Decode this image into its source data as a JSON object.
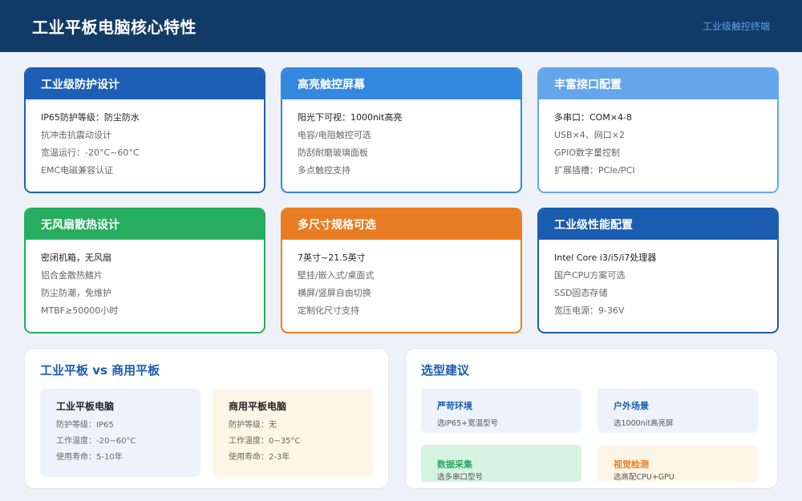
{
  "header": {
    "title": "工业平板电脑核心特性",
    "tag": "工业级触控终端"
  },
  "colors": {
    "header_bg": "#123a66",
    "blue_dark": "#1c5fb5",
    "blue_mid": "#3388e0",
    "blue_light": "#64a6ec",
    "green": "#27ad5f",
    "orange": "#e87c22",
    "blue_deep": "#1a5cb0"
  },
  "cards": [
    {
      "title": "工业级防护设计",
      "items": [
        "IP65防护等级：防尘防水",
        "抗冲击抗震动设计",
        "宽温运行：-20°C~60°C",
        "EMC电磁兼容认证"
      ]
    },
    {
      "title": "高亮触控屏幕",
      "items": [
        "阳光下可视：1000nit高亮",
        "电容/电阻触控可选",
        "防刮耐磨玻璃面板",
        "多点触控支持"
      ]
    },
    {
      "title": "丰富接口配置",
      "items": [
        "多串口：COM×4-8",
        "USB×4、网口×2",
        "GPIO数字量控制",
        "扩展插槽：PCIe/PCI"
      ]
    },
    {
      "title": "无风扇散热设计",
      "items": [
        "密闭机箱，无风扇",
        "铝合金散热鳍片",
        "防尘防潮，免维护",
        "MTBF≥50000小时"
      ]
    },
    {
      "title": "多尺寸规格可选",
      "items": [
        "7英寸~21.5英寸",
        "壁挂/嵌入式/桌面式",
        "横屏/竖屏自由切换",
        "定制化尺寸支持"
      ]
    },
    {
      "title": "工业级性能配置",
      "items": [
        "Intel Core i3/i5/i7处理器",
        "国产CPU方案可选",
        "SSD固态存储",
        "宽压电源：9-36V"
      ]
    }
  ],
  "compare": {
    "title": "工业平板 vs 商用平板",
    "industrial": {
      "title": "工业平板电脑",
      "lines": [
        "防护等级：IP65",
        "工作温度：-20~60°C",
        "使用寿命：5-10年"
      ]
    },
    "commercial": {
      "title": "商用平板电脑",
      "lines": [
        "防护等级：无",
        "工作温度：0~35°C",
        "使用寿命：2-3年"
      ]
    }
  },
  "advice": {
    "title": "选型建议",
    "tips": [
      {
        "title": "严苛环境",
        "desc": "选IP65+宽温型号"
      },
      {
        "title": "户外场景",
        "desc": "选1000nit高亮屏"
      },
      {
        "title": "数据采集",
        "desc": "选多串口型号"
      },
      {
        "title": "视觉检测",
        "desc": "选高配CPU+GPU"
      }
    ]
  }
}
